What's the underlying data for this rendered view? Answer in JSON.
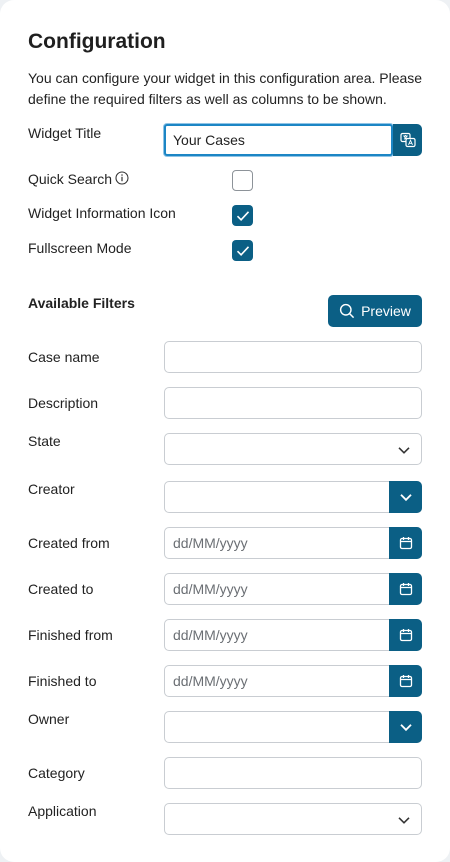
{
  "header": {
    "title": "Configuration",
    "description": "You can configure your widget in this configuration area. Please define the required filters as well as columns to be shown."
  },
  "settings": {
    "widget_title_label": "Widget Title",
    "widget_title_value": "Your Cases",
    "quick_search_label": "Quick Search",
    "quick_search_checked": false,
    "info_icon_label": "Widget Information Icon",
    "info_icon_checked": true,
    "fullscreen_label": "Fullscreen Mode",
    "fullscreen_checked": true
  },
  "filters": {
    "section_label": "Available Filters",
    "preview_label": "Preview",
    "case_name_label": "Case name",
    "description_label": "Description",
    "state_label": "State",
    "creator_label": "Creator",
    "created_from_label": "Created from",
    "created_to_label": "Created to",
    "finished_from_label": "Finished from",
    "finished_to_label": "Finished to",
    "date_placeholder": "dd/MM/yyyy",
    "owner_label": "Owner",
    "category_label": "Category",
    "application_label": "Application"
  },
  "colors": {
    "accent": "#0b5f85",
    "focus": "#1c86c5"
  }
}
